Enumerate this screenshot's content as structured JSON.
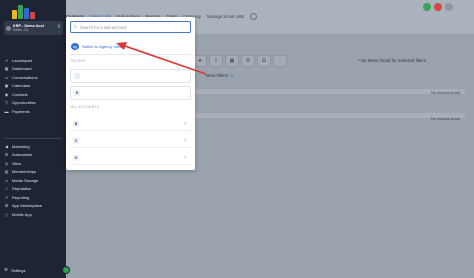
{
  "sidebar": {
    "logo_colors": [
      "#e8b923",
      "#3aa35a",
      "#2f6bd6",
      "#d64545"
    ],
    "account": {
      "name": "KRP - Demo Acct",
      "location": "Dallas, CA",
      "chevron_icon": "chevron-updown-icon"
    },
    "items": [
      {
        "label": "Launchpad",
        "icon": "rocket-icon"
      },
      {
        "label": "Dashboard",
        "icon": "dashboard-icon"
      },
      {
        "label": "Conversations",
        "icon": "chat-icon"
      },
      {
        "label": "Calendars",
        "icon": "calendar-icon"
      },
      {
        "label": "Contacts",
        "icon": "contacts-icon"
      },
      {
        "label": "Opportunities",
        "icon": "funnel-icon"
      },
      {
        "label": "Payments",
        "icon": "card-icon"
      }
    ],
    "items2": [
      {
        "label": "Marketing",
        "icon": "megaphone-icon"
      },
      {
        "label": "Automation",
        "icon": "automation-icon"
      },
      {
        "label": "Sites",
        "icon": "globe-icon"
      },
      {
        "label": "Memberships",
        "icon": "membership-icon"
      },
      {
        "label": "Media Storage",
        "icon": "folder-icon"
      },
      {
        "label": "Reputation",
        "icon": "star-icon"
      },
      {
        "label": "Reporting",
        "icon": "chart-icon"
      },
      {
        "label": "App Marketplace",
        "icon": "apps-icon"
      },
      {
        "label": "Mobile App",
        "icon": "phone-icon"
      }
    ],
    "settings_label": "Settings",
    "help_color": "#2fa24f"
  },
  "header": {
    "tabs": [
      "Contacts",
      "Smart Lists",
      "Bulk Actions",
      "Restore",
      "Tasks",
      "Company",
      "Manage Smart Lists"
    ],
    "avatar_colors": [
      "#3aa35a",
      "#d64545",
      "#8d95a3"
    ]
  },
  "main": {
    "no_items_text": "No items found for selected filters",
    "more_filters_label": "More Filters",
    "no_records_text": "No records found",
    "toolbar_icons": [
      "star-icon",
      "import-icon",
      "filter-icon",
      "settings-icon",
      "list-icon",
      "more-icon"
    ]
  },
  "dropdown": {
    "search_placeholder": "Search for a sub-account",
    "switch_badge": "Ag",
    "switch_label": "Switch to Agency View",
    "recent_label": "RECENT",
    "recent_accounts": [
      "",
      "H"
    ],
    "all_accounts_label": "ALL ACCOUNTS",
    "all_accounts": [
      "B",
      "C",
      "G"
    ]
  },
  "annotation": {
    "arrow_color": "#d93636"
  }
}
